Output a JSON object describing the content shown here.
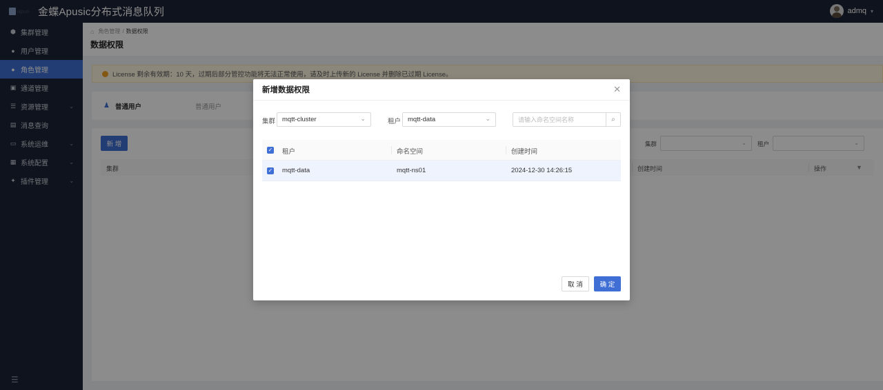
{
  "app": {
    "title": "金蝶Apusic分布式消息队列",
    "logo_alt": "apus",
    "user": "admq"
  },
  "sidebar": {
    "items": [
      {
        "label": "集群管理",
        "icon": "cluster-icon"
      },
      {
        "label": "用户管理",
        "icon": "user-icon"
      },
      {
        "label": "角色管理",
        "icon": "role-icon",
        "active": true
      },
      {
        "label": "通道管理",
        "icon": "channel-icon"
      },
      {
        "label": "资源管理",
        "icon": "resource-icon",
        "expandable": true
      },
      {
        "label": "消息查询",
        "icon": "message-query-icon"
      },
      {
        "label": "系统运维",
        "icon": "ops-icon",
        "expandable": true
      },
      {
        "label": "系统配置",
        "icon": "config-icon",
        "expandable": true
      },
      {
        "label": "插件管理",
        "icon": "plugin-icon",
        "expandable": true
      }
    ]
  },
  "breadcrumb": {
    "parent": "角色管理",
    "separator": "/",
    "current": "数据权限"
  },
  "page": {
    "title": "数据权限"
  },
  "license": {
    "message": "License 剩余有效期：10 天，过期后部分管控功能将无法正常使用，请及时上传新的 License 并删除已过期 License。"
  },
  "role": {
    "name": "普通用户",
    "description": "普通用户"
  },
  "main": {
    "add_label": "新 增",
    "filters": {
      "cluster_label": "集群",
      "tenant_label": "租户"
    },
    "columns": [
      "集群",
      "创建时间",
      "操作"
    ]
  },
  "modal": {
    "title": "新增数据权限",
    "cluster_label": "集群",
    "cluster_value": "mqtt-cluster",
    "tenant_label": "租户",
    "tenant_value": "mqtt-data",
    "search_placeholder": "请输入命名空间名称",
    "columns": [
      "租户",
      "命名空间",
      "创建时间"
    ],
    "rows": [
      {
        "tenant": "mqtt-data",
        "namespace": "mqtt-ns01",
        "created": "2024-12-30 14:26:15",
        "checked": true
      }
    ],
    "cancel_label": "取 消",
    "ok_label": "确 定"
  },
  "colors": {
    "primary": "#3f6ed4",
    "sidebar_bg": "#1c2435",
    "warning": "#f0a020"
  }
}
